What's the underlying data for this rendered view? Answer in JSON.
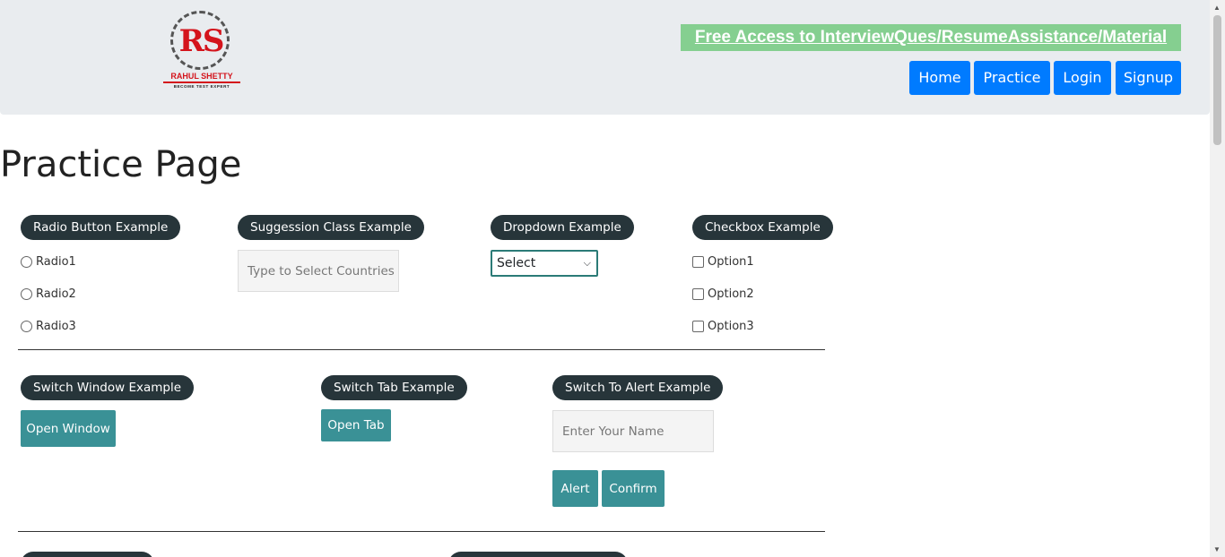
{
  "header": {
    "logo_mark": "RS",
    "logo_name": "RAHUL SHETTY",
    "logo_tagline": "BECOME TEST EXPERT",
    "promo_link": "Free Access to InterviewQues/ResumeAssistance/Material",
    "nav": {
      "home": "Home",
      "practice": "Practice",
      "login": "Login",
      "signup": "Signup"
    }
  },
  "page_title": "Practice Page",
  "radio_section": {
    "title": "Radio Button Example",
    "options": [
      "Radio1",
      "Radio2",
      "Radio3"
    ]
  },
  "suggestion_section": {
    "title": "Suggession Class Example",
    "placeholder": "Type to Select Countries"
  },
  "dropdown_section": {
    "title": "Dropdown Example",
    "selected": "Select"
  },
  "checkbox_section": {
    "title": "Checkbox Example",
    "options": [
      "Option1",
      "Option2",
      "Option3"
    ]
  },
  "switch_window": {
    "title": "Switch Window Example",
    "button": "Open Window"
  },
  "switch_tab": {
    "title": "Switch Tab Example",
    "button": "Open Tab"
  },
  "alert_section": {
    "title": "Switch To Alert Example",
    "placeholder": "Enter Your Name",
    "alert_button": "Alert",
    "confirm_button": "Confirm"
  },
  "colors": {
    "nav_blue": "#007bff",
    "pill_dark": "#27353a",
    "teal": "#3a9196",
    "promo_green": "#85cf90",
    "brand_red": "#d4141c"
  }
}
